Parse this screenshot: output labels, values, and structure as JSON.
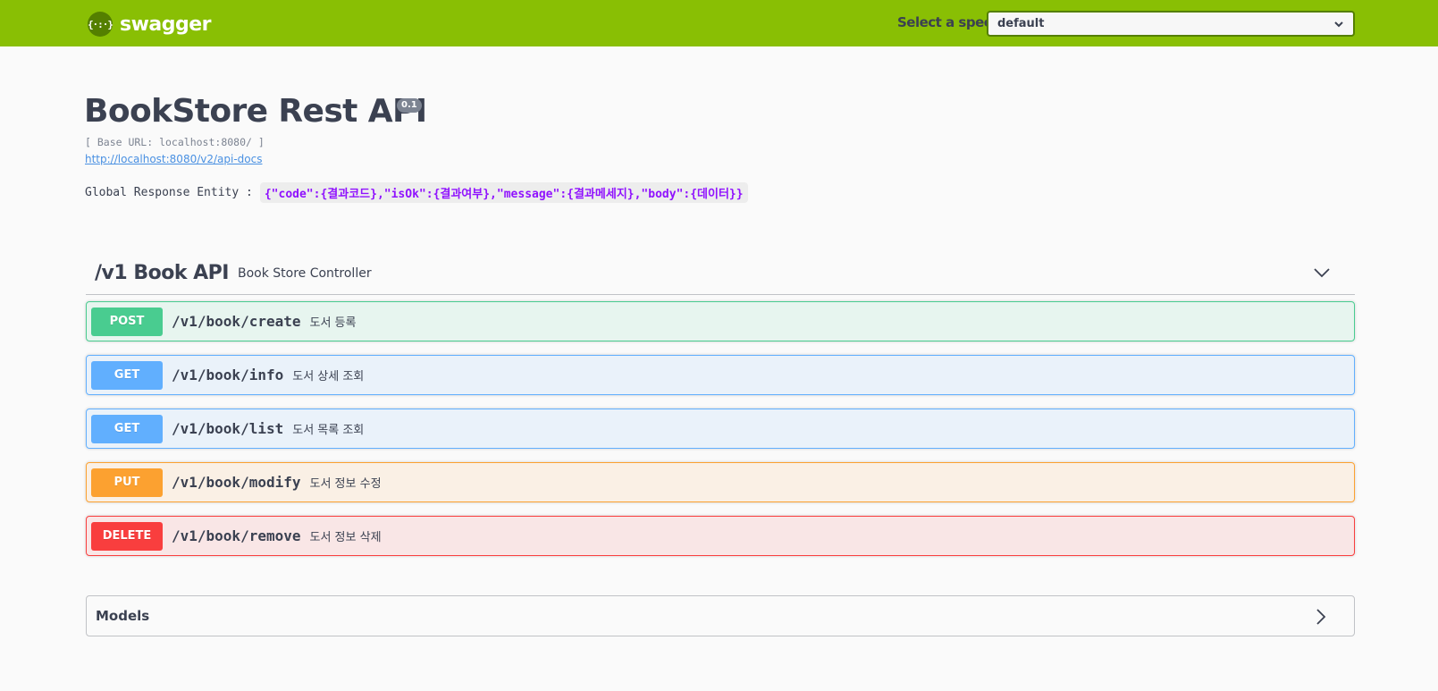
{
  "topbar": {
    "logo_mark": "{·:·}",
    "logo_text": "swagger",
    "spec_label": "Select a spec",
    "spec_value": "default"
  },
  "info": {
    "title": "BookStore Rest API",
    "version": "0.1",
    "base_url": "[ Base URL: localhost:8080/ ]",
    "docs_link": "http://localhost:8080/v2/api-docs",
    "global_label": "Global Response Entity :",
    "global_code": "{\"code\":{결과코드},\"isOk\":{결과여부},\"message\":{결과메세지},\"body\":{데이터}}"
  },
  "tag": {
    "name": "/v1 Book API",
    "description": "Book Store Controller"
  },
  "operations": [
    {
      "method": "POST",
      "path": "/v1/book/create",
      "summary": "도서 등록",
      "color": "#49cc90",
      "bg": "rgba(73,204,144,0.1)"
    },
    {
      "method": "GET",
      "path": "/v1/book/info",
      "summary": "도서 상세 조회",
      "color": "#61affe",
      "bg": "rgba(97,175,254,0.1)"
    },
    {
      "method": "GET",
      "path": "/v1/book/list",
      "summary": "도서 목록 조회",
      "color": "#61affe",
      "bg": "rgba(97,175,254,0.1)"
    },
    {
      "method": "PUT",
      "path": "/v1/book/modify",
      "summary": "도서 정보 수정",
      "color": "#fca130",
      "bg": "rgba(252,161,48,0.1)"
    },
    {
      "method": "DELETE",
      "path": "/v1/book/remove",
      "summary": "도서 정보 삭제",
      "color": "#f93e3e",
      "bg": "rgba(249,62,62,0.1)"
    }
  ],
  "models": {
    "title": "Models"
  },
  "icons": {
    "logo": "swagger-logo-icon",
    "select": "chevron-down-icon",
    "tag_toggle": "chevron-down-icon",
    "models_toggle": "chevron-right-icon"
  }
}
